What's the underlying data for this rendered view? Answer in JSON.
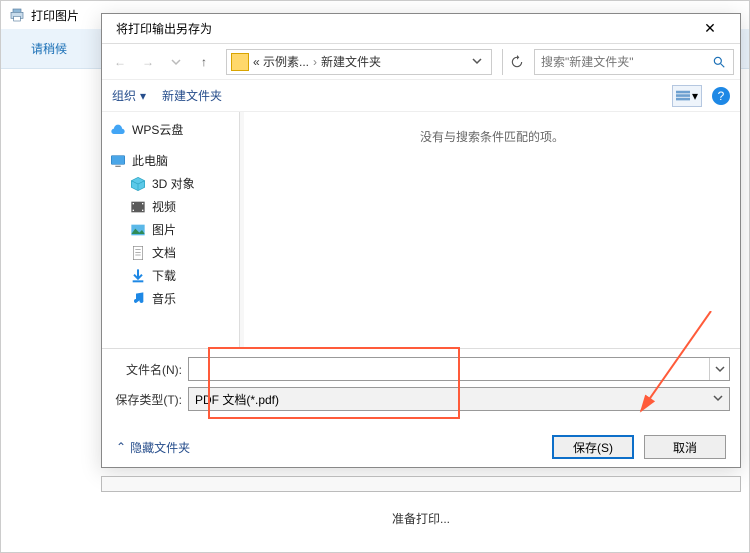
{
  "outer": {
    "title": "打印图片"
  },
  "wait": {
    "text": "请稍候"
  },
  "dialog": {
    "title": "将打印输出另存为",
    "breadcrumb": {
      "part1": "« 示例素...",
      "part2": "新建文件夹"
    },
    "search_placeholder": "搜索\"新建文件夹\"",
    "toolbar": {
      "organize": "组织",
      "newFolder": "新建文件夹"
    },
    "tree": {
      "wps": "WPS云盘",
      "pc": "此电脑",
      "items": [
        "3D 对象",
        "视频",
        "图片",
        "文档",
        "下载",
        "音乐"
      ]
    },
    "empty": "没有与搜索条件匹配的项。",
    "form": {
      "fileLabel": "文件名(N):",
      "typeLabel": "保存类型(T):",
      "typeValue": "PDF 文档(*.pdf)"
    },
    "footer": {
      "hide": "隐藏文件夹",
      "save": "保存(S)",
      "cancel": "取消"
    }
  },
  "progress": {
    "text": "准备打印..."
  }
}
